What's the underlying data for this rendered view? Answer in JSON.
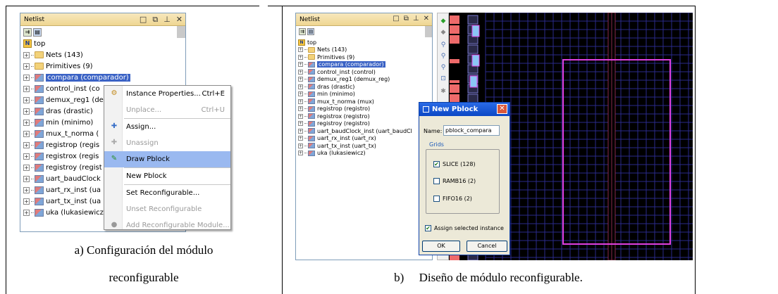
{
  "panel_a": {
    "title": "Netlist",
    "window_controls": [
      "□",
      "⧉",
      "⊥",
      "✕"
    ],
    "tree": {
      "root": "top",
      "nodes": [
        {
          "label": "Nets (143)",
          "kind": "folder"
        },
        {
          "label": "Primitives (9)",
          "kind": "folder"
        },
        {
          "label": "compara (comparador)",
          "kind": "instance",
          "selected": true
        },
        {
          "label": "control_inst (co",
          "kind": "instance"
        },
        {
          "label": "demux_reg1 (de",
          "kind": "instance"
        },
        {
          "label": "dras (drastic)",
          "kind": "instance"
        },
        {
          "label": "min (minimo)",
          "kind": "instance"
        },
        {
          "label": "mux_t_norma (",
          "kind": "instance"
        },
        {
          "label": "registrop (regis",
          "kind": "instance"
        },
        {
          "label": "registrox (regis",
          "kind": "instance"
        },
        {
          "label": "registroy (regist",
          "kind": "instance"
        },
        {
          "label": "uart_baudClock",
          "kind": "instance"
        },
        {
          "label": "uart_rx_inst (ua",
          "kind": "instance"
        },
        {
          "label": "uart_tx_inst (ua",
          "kind": "instance"
        },
        {
          "label": "uka (lukasiewicz",
          "kind": "instance"
        }
      ]
    }
  },
  "context_menu": {
    "items": [
      {
        "label": "Instance Properties...",
        "shortcut": "Ctrl+E",
        "enabled": true,
        "icon": "properties-icon"
      },
      {
        "label": "Unplace...",
        "shortcut": "Ctrl+U",
        "enabled": false,
        "icon": ""
      },
      {
        "label": "Assign...",
        "shortcut": "",
        "enabled": true,
        "icon": "assign-icon"
      },
      {
        "label": "Unassign",
        "shortcut": "",
        "enabled": false,
        "icon": "unassign-icon"
      },
      {
        "label": "Draw Pblock",
        "shortcut": "",
        "enabled": true,
        "highlighted": true,
        "icon": "draw-pblock-icon"
      },
      {
        "label": "New Pblock",
        "shortcut": "",
        "enabled": true,
        "icon": ""
      },
      {
        "label": "Set Reconfigurable...",
        "shortcut": "",
        "enabled": true,
        "icon": ""
      },
      {
        "label": "Unset Reconfigurable",
        "shortcut": "",
        "enabled": false,
        "icon": ""
      },
      {
        "label": "Add Reconfigurable Module...",
        "shortcut": "",
        "enabled": false,
        "icon": "add-module-icon"
      }
    ]
  },
  "panel_b": {
    "title": "Netlist",
    "window_controls": [
      "□",
      "⧉",
      "⊥",
      "✕"
    ],
    "tree": {
      "root": "top",
      "nodes": [
        {
          "label": "Nets (143)",
          "kind": "folder"
        },
        {
          "label": "Primitives (9)",
          "kind": "folder"
        },
        {
          "label": "compara (comparador)",
          "kind": "instance",
          "selected": true
        },
        {
          "label": "control_inst (control)",
          "kind": "instance"
        },
        {
          "label": "demux_reg1 (demux_reg)",
          "kind": "instance"
        },
        {
          "label": "dras (drastic)",
          "kind": "instance"
        },
        {
          "label": "min (minimo)",
          "kind": "instance"
        },
        {
          "label": "mux_t_norma (mux)",
          "kind": "instance"
        },
        {
          "label": "registrop (registro)",
          "kind": "instance"
        },
        {
          "label": "registrox (registro)",
          "kind": "instance"
        },
        {
          "label": "registroy (registro)",
          "kind": "instance"
        },
        {
          "label": "uart_baudClock_inst (uart_baudCl",
          "kind": "instance"
        },
        {
          "label": "uart_rx_inst (uart_rx)",
          "kind": "instance"
        },
        {
          "label": "uart_tx_inst (uart_tx)",
          "kind": "instance"
        },
        {
          "label": "uka (lukasiewicz)",
          "kind": "instance"
        }
      ]
    }
  },
  "dialog": {
    "title": "New Pblock",
    "name_label": "Name:",
    "name_value": "pblock_compara",
    "grids_label": "Grids",
    "grids": [
      {
        "label": "SLICE (128)",
        "checked": true
      },
      {
        "label": "RAMB16 (2)",
        "checked": false
      },
      {
        "label": "FIFO16 (2)",
        "checked": false
      }
    ],
    "assign_label": "Assign selected instance",
    "assign_checked": true,
    "ok_label": "OK",
    "cancel_label": "Cancel"
  },
  "colors": {
    "selection": "#3a62c5",
    "menu_highlight": "#9ab9f0",
    "pblock_outline": "#e040e0",
    "dialog_title": "#0b47c5"
  },
  "captions": {
    "a_line1": "a) Configuración del módulo",
    "a_line2": "reconfigurable",
    "b": "b)     Diseño de módulo reconfigurable."
  }
}
